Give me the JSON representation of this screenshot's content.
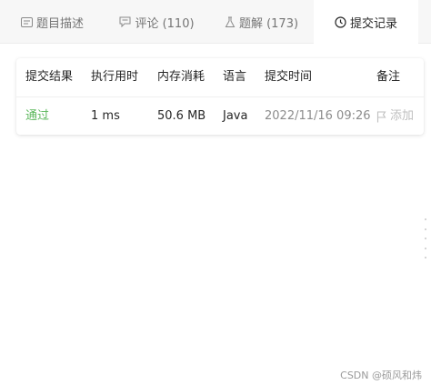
{
  "tabs": [
    {
      "label": "题目描述",
      "icon": "description-icon",
      "active": false
    },
    {
      "label": "评论 (110)",
      "icon": "comment-icon",
      "active": false
    },
    {
      "label": "题解 (173)",
      "icon": "flask-icon",
      "active": false
    },
    {
      "label": "提交记录",
      "icon": "clock-icon",
      "active": true
    }
  ],
  "table": {
    "headers": [
      "提交结果",
      "执行用时",
      "内存消耗",
      "语言",
      "提交时间",
      "备注"
    ],
    "rows": [
      {
        "status": "通过",
        "runtime": "1 ms",
        "memory": "50.6 MB",
        "language": "Java",
        "time": "2022/11/16 09:26",
        "note": "添加"
      }
    ]
  },
  "watermark": "CSDN @硕风和炜",
  "colors": {
    "accent_success": "#5cb85c",
    "tabbar_bg": "#f7f7f7",
    "muted_text": "#8c8c8c"
  }
}
